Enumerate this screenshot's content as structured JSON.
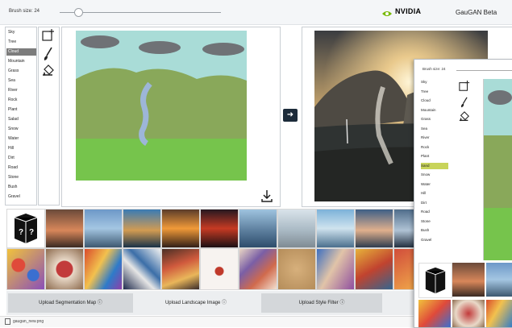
{
  "topbar": {
    "brush_label": "Brush size: 24",
    "brand": "NVIDIA",
    "app_title": "GauGAN Beta"
  },
  "labels": [
    "Sky",
    "Tree",
    "Cloud",
    "Mountain",
    "Grass",
    "Sea",
    "River",
    "Rock",
    "Plant",
    "Salad",
    "Snow",
    "Water",
    "Hill",
    "Dirt",
    "Road",
    "Stone",
    "Bush",
    "Gravel"
  ],
  "selected_label_index": 2,
  "tools": [
    "add-canvas-icon",
    "brush-icon",
    "fill-bucket-icon"
  ],
  "actions": {
    "transfer_arrow": "➜",
    "download_icon": "download-icon"
  },
  "bottom": {
    "upload_segmentation": "Upload Segmentation Map",
    "upload_landscape": "Upload Landscape Image",
    "upload_style": "Upload Style Filter"
  },
  "status": {
    "file": "gaugan_new.png"
  },
  "overlay": {
    "brush_label": "Brush size: 24",
    "labels": [
      "Sky",
      "Tree",
      "Cloud",
      "Mountain",
      "Grass",
      "Sea",
      "River",
      "Rock",
      "Plant",
      "Sand",
      "Snow",
      "Water",
      "Hill",
      "Dirt",
      "Road",
      "Stone",
      "Bush",
      "Gravel"
    ],
    "selected_label_index": 9
  },
  "colors": {
    "sky": "#a9dcd7",
    "mountain": "#89a85a",
    "grass": "#76c44c",
    "cloud": "#6f7276",
    "river": "#9db6d8",
    "accent": "#76b900"
  }
}
